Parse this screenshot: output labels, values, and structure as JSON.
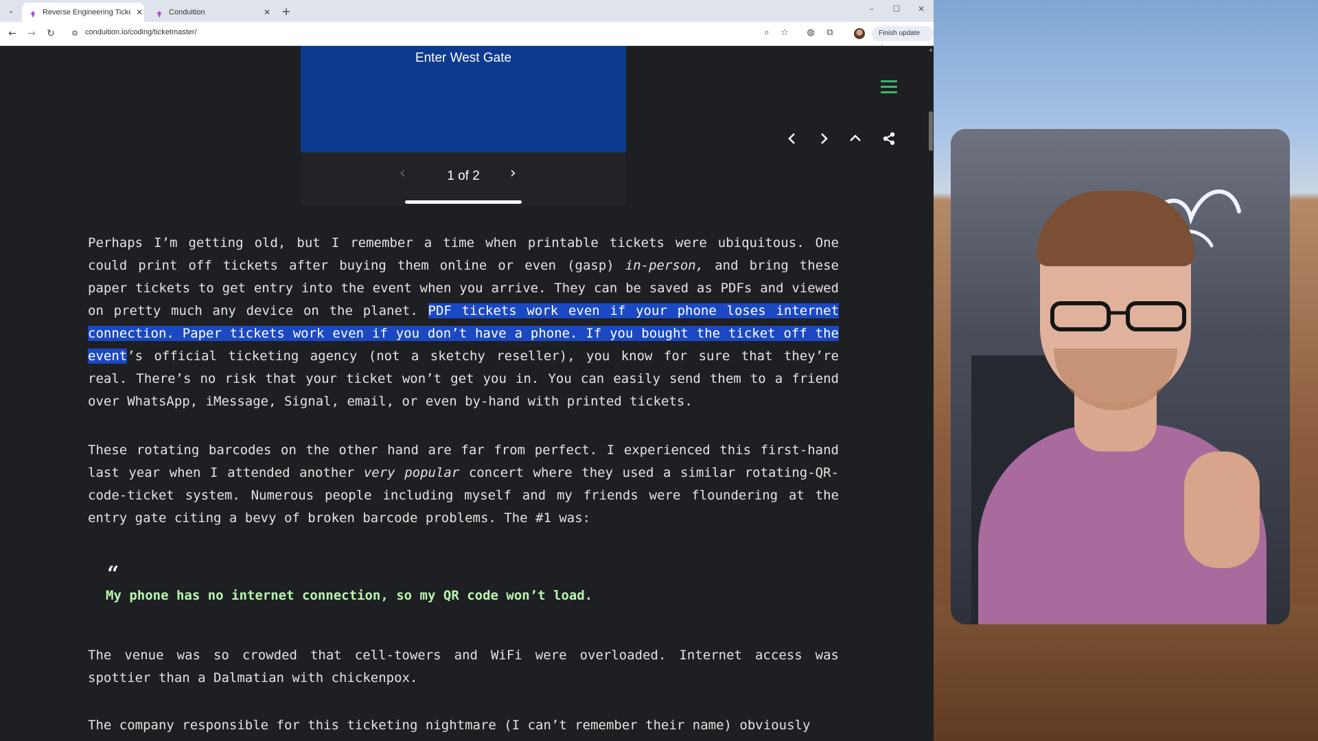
{
  "browser": {
    "tabs": [
      {
        "title": "Reverse Engineering TicketMas",
        "active": true
      },
      {
        "title": "Conduition",
        "active": false
      }
    ],
    "url": "conduition.io/coding/ticketmaster/",
    "finish_update_label": "Finish update",
    "icons": {
      "tab_search": "chevron-down-icon",
      "new_tab": "plus-icon",
      "back": "back-arrow-icon",
      "forward": "forward-arrow-icon",
      "reload": "reload-icon",
      "site_info": "site-info-icon",
      "zoom": "zoom-icon",
      "bookmark": "star-icon",
      "extension": "extension-icon",
      "puzzle": "puzzle-icon"
    }
  },
  "ticket": {
    "gate": "Enter West Gate",
    "pager": "1 of 2"
  },
  "article": {
    "p1_a": "Perhaps I’m getting old, but I remember a time when printable tickets were ubiquitous. One could print off tickets after buying them online or even (gasp) ",
    "p1_em": "in-person,",
    "p1_b": " and bring these paper tickets to get entry into the event when you arrive. They can be saved as PDFs and viewed on pretty much any device on the planet. ",
    "p1_hl": "PDF tickets work even if your phone loses internet connection. Paper tickets work even if you don’t have a phone. If you bought the ticket off the event",
    "p1_c": "’s official ticketing agency (not a sketchy reseller), you know for sure that they’re real. There’s no risk that your ticket won’t get you in. You can easily send them to a friend over WhatsApp, iMessage, Signal, email, or even by-hand with printed tickets.",
    "p2_a": "These rotating barcodes on the other hand are far from perfect. I experienced this first-hand last year when I attended another ",
    "p2_em": "very popular",
    "p2_b": " concert where they used a similar rotating-QR-code-ticket system. Numerous people including myself and my friends were floundering at the entry gate citing a bevy of broken barcode problems. The #1 was:",
    "quote_mark": "“",
    "quote": "My phone has no internet connection, so my QR code won’t load.",
    "p3": "The venue was so crowded that cell-towers and WiFi were overloaded. Internet access was spottier than a Dalmatian with chickenpox.",
    "p4": "The company responsible for this ticketing nightmare (I can’t remember their name) obviously"
  },
  "colors": {
    "page_bg": "#1e1f22",
    "ticket_blue": "#0c3a8e",
    "selection": "#1b49c4",
    "quote_green": "#b9f7b1",
    "menu_green": "#3fb56a"
  }
}
